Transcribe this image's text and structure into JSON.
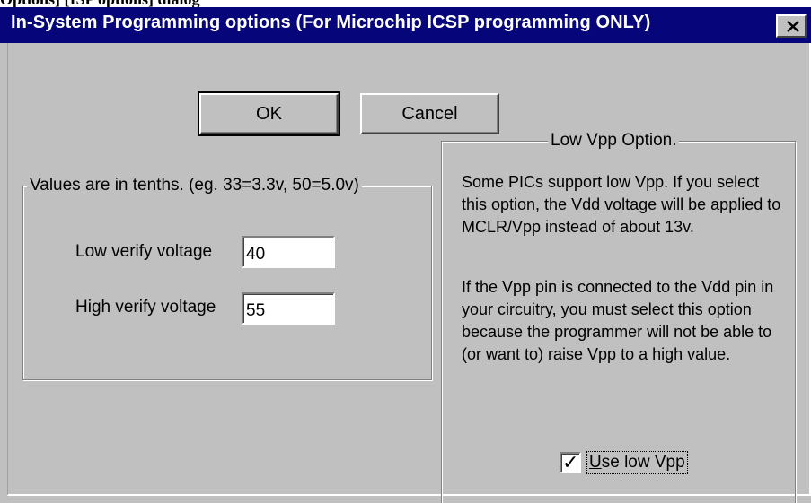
{
  "top_clipped_text": "Options] [ISP options] dialog",
  "dialog": {
    "title": "In-System Programming options (For Microchip ICSP programming ONLY)",
    "close_glyph": "✕"
  },
  "buttons": {
    "ok_label": "OK",
    "cancel_label": "Cancel"
  },
  "values_group": {
    "legend": "Values are in tenths. (eg. 33=3.3v, 50=5.0v)",
    "low_label": "Low verify voltage",
    "low_value": "40",
    "high_label": "High verify voltage",
    "high_value": "55"
  },
  "low_vpp_group": {
    "legend": "Low Vpp Option.",
    "para1": "Some PICs support low Vpp. If you select this option, the Vdd voltage will be applied to MCLR/Vpp instead of about 13v.",
    "para2": "If the Vpp pin is connected to the Vdd pin in your circuitry, you must select this option because the programmer will not be able to (or want to) raise Vpp to a high value.",
    "checkbox_label_mnemonic": "U",
    "checkbox_label_rest": "se low Vpp",
    "checkbox_checked": true,
    "check_glyph": "✓"
  },
  "colors": {
    "titlebar": "#06067a",
    "face": "#c0c0c0"
  }
}
